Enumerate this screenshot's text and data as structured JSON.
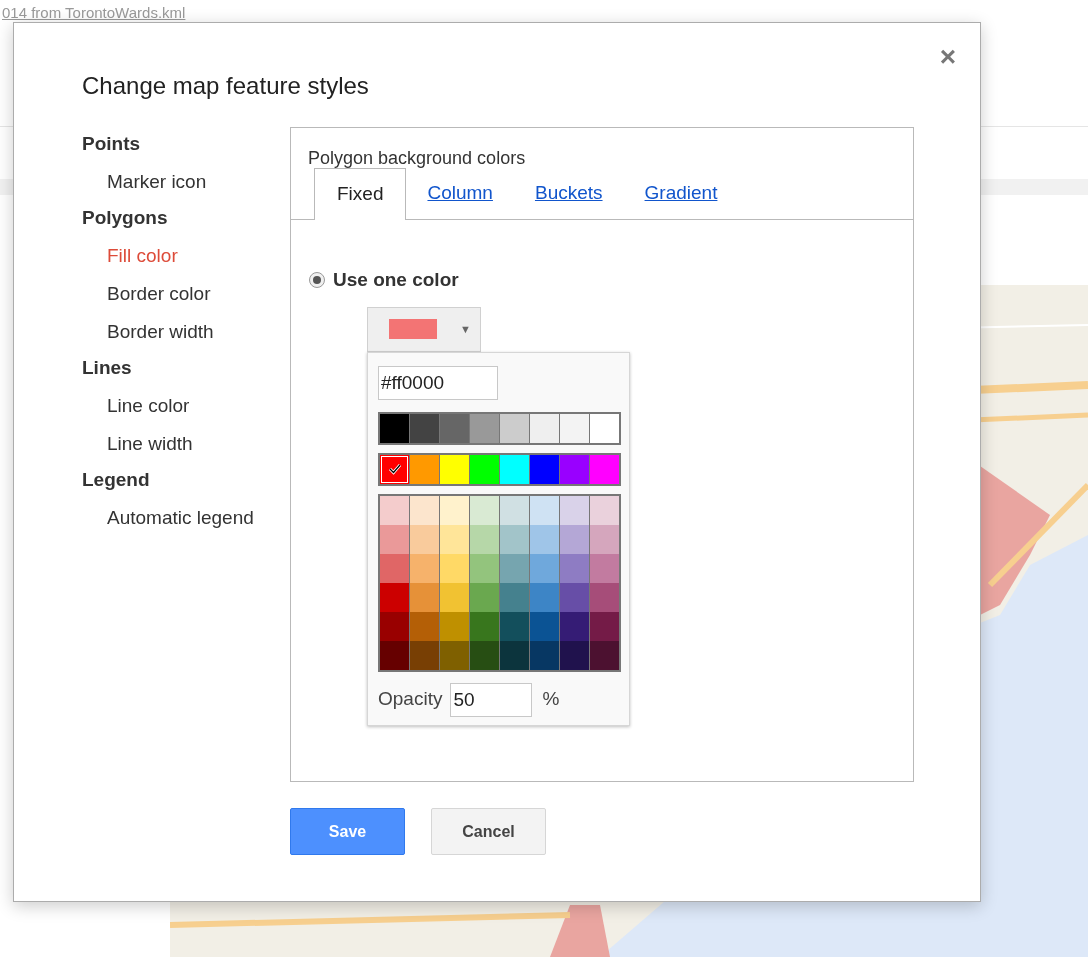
{
  "page": {
    "title": "014 from TorontoWards.kml"
  },
  "dialog": {
    "title": "Change map feature styles",
    "close": "×",
    "sidebar": [
      {
        "heading": "Points",
        "items": [
          {
            "label": "Marker icon",
            "selected": false
          }
        ]
      },
      {
        "heading": "Polygons",
        "items": [
          {
            "label": "Fill color",
            "selected": true
          },
          {
            "label": "Border color",
            "selected": false
          },
          {
            "label": "Border width",
            "selected": false
          }
        ]
      },
      {
        "heading": "Lines",
        "items": [
          {
            "label": "Line color",
            "selected": false
          },
          {
            "label": "Line width",
            "selected": false
          }
        ]
      },
      {
        "heading": "Legend",
        "items": [
          {
            "label": "Automatic legend",
            "selected": false
          }
        ]
      }
    ],
    "panel": {
      "title": "Polygon background colors",
      "tabs": [
        {
          "label": "Fixed",
          "selected": true
        },
        {
          "label": "Column",
          "selected": false
        },
        {
          "label": "Buckets",
          "selected": false
        },
        {
          "label": "Gradient",
          "selected": false
        }
      ],
      "radio": {
        "label": "Use one color",
        "checked": true
      },
      "color_button": {
        "color": "#f37474",
        "caret": "▼"
      },
      "picker": {
        "hex_value": "#ff0000",
        "gray_row": [
          {
            "color": "#000000",
            "selected": false
          },
          {
            "color": "#434343",
            "selected": false
          },
          {
            "color": "#666666",
            "selected": false
          },
          {
            "color": "#999999",
            "selected": false
          },
          {
            "color": "#cccccc",
            "selected": false
          },
          {
            "color": "#efefef",
            "selected": false
          },
          {
            "color": "#f3f3f3",
            "selected": false
          },
          {
            "color": "#ffffff",
            "selected": false
          }
        ],
        "bright_row": [
          {
            "color": "#ff0000",
            "selected": true
          },
          {
            "color": "#ff9900",
            "selected": false
          },
          {
            "color": "#ffff00",
            "selected": false
          },
          {
            "color": "#00ff00",
            "selected": false
          },
          {
            "color": "#00ffff",
            "selected": false
          },
          {
            "color": "#0000ff",
            "selected": false
          },
          {
            "color": "#9900ff",
            "selected": false
          },
          {
            "color": "#ff00ff",
            "selected": false
          }
        ],
        "grid": [
          [
            {
              "color": "#f4cccc",
              "selected": false
            },
            {
              "color": "#fce5cd",
              "selected": false
            },
            {
              "color": "#fff2cc",
              "selected": false
            },
            {
              "color": "#d9ead3",
              "selected": false
            },
            {
              "color": "#d0e0e3",
              "selected": false
            },
            {
              "color": "#cfe2f3",
              "selected": false
            },
            {
              "color": "#d9d2e9",
              "selected": false
            },
            {
              "color": "#ead1dc",
              "selected": false
            }
          ],
          [
            {
              "color": "#ea9999",
              "selected": false
            },
            {
              "color": "#f9cb9c",
              "selected": false
            },
            {
              "color": "#ffe599",
              "selected": false
            },
            {
              "color": "#b6d7a8",
              "selected": false
            },
            {
              "color": "#a2c4c9",
              "selected": false
            },
            {
              "color": "#9fc5e8",
              "selected": false
            },
            {
              "color": "#b4a7d6",
              "selected": false
            },
            {
              "color": "#d5a6bd",
              "selected": false
            }
          ],
          [
            {
              "color": "#e06666",
              "selected": false
            },
            {
              "color": "#f6b26b",
              "selected": false
            },
            {
              "color": "#ffd966",
              "selected": false
            },
            {
              "color": "#93c47d",
              "selected": false
            },
            {
              "color": "#76a5af",
              "selected": false
            },
            {
              "color": "#6fa8dc",
              "selected": false
            },
            {
              "color": "#8e7cc3",
              "selected": false
            },
            {
              "color": "#c27ba0",
              "selected": false
            }
          ],
          [
            {
              "color": "#cc0000",
              "selected": false
            },
            {
              "color": "#e69138",
              "selected": false
            },
            {
              "color": "#f1c232",
              "selected": false
            },
            {
              "color": "#6aa84f",
              "selected": false
            },
            {
              "color": "#45818e",
              "selected": false
            },
            {
              "color": "#3d85c6",
              "selected": false
            },
            {
              "color": "#674ea7",
              "selected": false
            },
            {
              "color": "#a64d79",
              "selected": false
            }
          ],
          [
            {
              "color": "#990000",
              "selected": false
            },
            {
              "color": "#b45f06",
              "selected": false
            },
            {
              "color": "#bf9000",
              "selected": false
            },
            {
              "color": "#38761d",
              "selected": false
            },
            {
              "color": "#134f5c",
              "selected": false
            },
            {
              "color": "#0b5394",
              "selected": false
            },
            {
              "color": "#351c75",
              "selected": false
            },
            {
              "color": "#741b47",
              "selected": false
            }
          ],
          [
            {
              "color": "#660000",
              "selected": false
            },
            {
              "color": "#783f04",
              "selected": false
            },
            {
              "color": "#7f6000",
              "selected": false
            },
            {
              "color": "#274e13",
              "selected": false
            },
            {
              "color": "#0c343d",
              "selected": false
            },
            {
              "color": "#073763",
              "selected": false
            },
            {
              "color": "#20124d",
              "selected": false
            },
            {
              "color": "#4c1130",
              "selected": false
            }
          ]
        ],
        "opacity_label": "Opacity",
        "opacity_value": "50",
        "opacity_unit": "%"
      }
    },
    "buttons": [
      {
        "label": "Save",
        "kind": "primary"
      },
      {
        "label": "Cancel",
        "kind": "secondary"
      }
    ]
  }
}
